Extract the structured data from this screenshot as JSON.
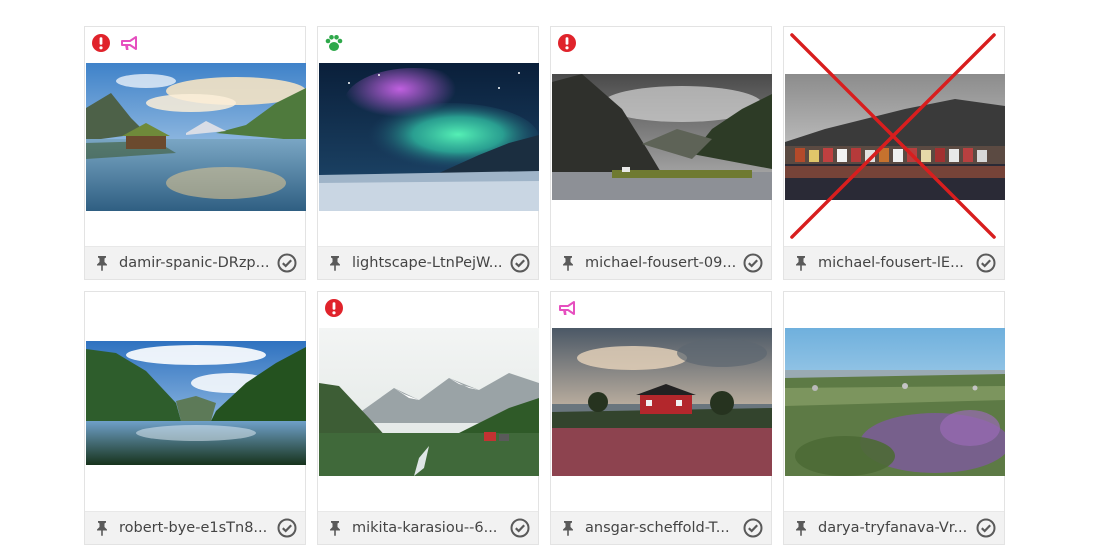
{
  "gallery": {
    "items": [
      {
        "filename": "damir-spanic-DRzp...",
        "badges": [
          "exclamation-circle-icon",
          "megaphone-icon"
        ],
        "excluded": false
      },
      {
        "filename": "lightscape-LtnPejW...",
        "badges": [
          "paw-icon"
        ],
        "excluded": false
      },
      {
        "filename": "michael-fousert-09...",
        "badges": [
          "exclamation-circle-icon"
        ],
        "excluded": false
      },
      {
        "filename": "michael-fousert-lE...",
        "badges": [],
        "excluded": true
      },
      {
        "filename": "robert-bye-e1sTn8...",
        "badges": [],
        "excluded": false
      },
      {
        "filename": "mikita-karasiou--6...",
        "badges": [
          "exclamation-circle-icon"
        ],
        "excluded": false
      },
      {
        "filename": "ansgar-scheffold-T...",
        "badges": [
          "megaphone-icon"
        ],
        "excluded": false
      },
      {
        "filename": "darya-tryfanava-Vr...",
        "badges": [],
        "excluded": false
      }
    ]
  },
  "colors": {
    "alert": "#e0232b",
    "megaphone": "#e64fbf",
    "paw": "#2ea84a",
    "excluded_x": "#d81e1e",
    "icon_gray": "#5a5a5a"
  }
}
